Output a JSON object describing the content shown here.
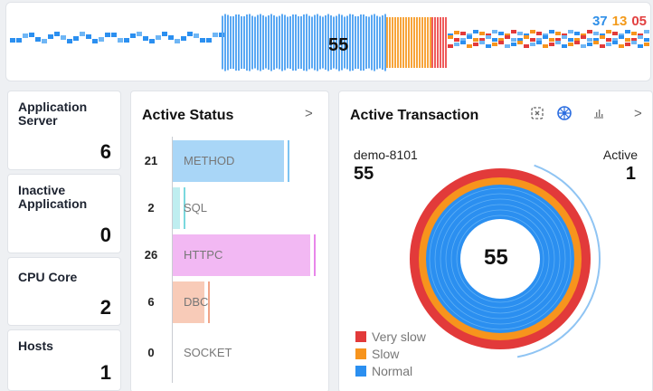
{
  "top_strip": {
    "center_value": "55",
    "counts": [
      {
        "value": "37",
        "color": "#2f8fe8"
      },
      {
        "value": "13",
        "color": "#f39a1a"
      },
      {
        "value": "05",
        "color": "#e24040"
      }
    ]
  },
  "metrics": [
    {
      "label": "Application Server",
      "value": "6"
    },
    {
      "label": "Inactive Application",
      "value": "0"
    },
    {
      "label": "CPU Core",
      "value": "2"
    },
    {
      "label": "Hosts",
      "value": "1"
    }
  ],
  "active_status": {
    "title": "Active Status",
    "chevron": ">",
    "rows": [
      {
        "count": "21",
        "label": "METHOD",
        "color": "#a9d6f7",
        "tick": "#7cc3f2",
        "fill_ratio": 0.81
      },
      {
        "count": "2",
        "label": "SQL",
        "color": "#bfeef0",
        "tick": "#7ad8de",
        "fill_ratio": 0.05
      },
      {
        "count": "26",
        "label": "HTTPC",
        "color": "#f2b8f3",
        "tick": "#e887ea",
        "fill_ratio": 1.0
      },
      {
        "count": "6",
        "label": "DBC",
        "color": "#f8cbb8",
        "tick": "#f0a489",
        "fill_ratio": 0.23
      },
      {
        "count": "0",
        "label": "SOCKET",
        "color": "#dddddd",
        "tick": "#cccccc",
        "fill_ratio": 0
      }
    ]
  },
  "active_transaction": {
    "title": "Active Transaction",
    "chevron": ">",
    "server_name": "demo-8101",
    "server_value": "55",
    "active_label": "Active",
    "active_value": "1",
    "donut_center": "55",
    "legend": [
      {
        "label": "Very slow",
        "color": "#e23a3a"
      },
      {
        "label": "Slow",
        "color": "#f7941d"
      },
      {
        "label": "Normal",
        "color": "#2b8ff0"
      }
    ]
  },
  "colors": {
    "very_slow": "#e23a3a",
    "slow": "#f7941d",
    "normal": "#2b8ff0",
    "panel_border": "#e0e3e8"
  },
  "icons": {
    "transaction_icons": [
      "expand-icon",
      "network-icon",
      "bar-chart-icon"
    ]
  }
}
